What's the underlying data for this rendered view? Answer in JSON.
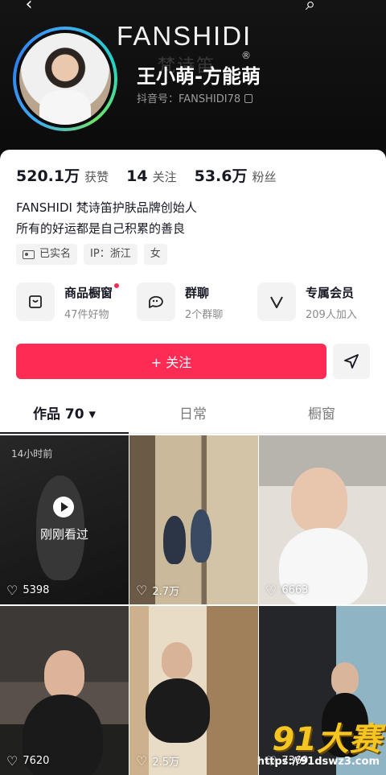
{
  "header": {
    "back_icon": "‹",
    "search_icon": "⌕",
    "brand": "FANSHIDI",
    "brand_sub": "梵诗笛",
    "display_name": "王小萌-方能萌",
    "registered_mark": "®",
    "handle": "抖音号：FANSHIDI78"
  },
  "stats": [
    {
      "value": "520.1万",
      "label": "获赞"
    },
    {
      "value": "14",
      "label": "关注"
    },
    {
      "value": "53.6万",
      "label": "粉丝"
    }
  ],
  "bio": {
    "line1": "FANSHIDI 梵诗笛护肤品牌创始人",
    "line2": "所有的好运都是自己积累的善良"
  },
  "tags": [
    "已实名",
    "IP：浙江",
    "女"
  ],
  "services": [
    {
      "title": "商品橱窗",
      "sub": "47件好物",
      "icon": "bag-icon"
    },
    {
      "title": "群聊",
      "sub": "2个群聊",
      "icon": "chat-icon"
    },
    {
      "title": "专属会员",
      "sub": "209人加入",
      "icon": "vip-icon"
    }
  ],
  "follow_label": "+ 关注",
  "tabs": [
    "作品 70 ▾",
    "日常",
    "橱窗"
  ],
  "videos": [
    {
      "time": "14小时前",
      "seen": "刚刚看过",
      "likes": "5398"
    },
    {
      "likes": "2.7万"
    },
    {
      "likes": "6663"
    },
    {
      "likes": "7620"
    },
    {
      "likes": "2.5万"
    },
    {
      "likes": "7369"
    }
  ],
  "watermark": {
    "logo": "91大赛",
    "url": "https://91dswz3.com"
  },
  "colors": {
    "accent": "#fe2c55",
    "header_bg": "#0b0b0b",
    "text": "#161823"
  }
}
